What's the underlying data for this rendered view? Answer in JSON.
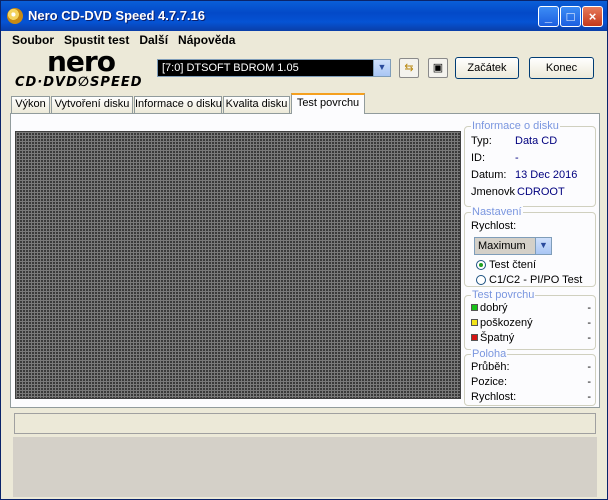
{
  "window": {
    "title": "Nero CD-DVD Speed 4.7.7.16"
  },
  "menu": [
    "Soubor",
    "Spustit test",
    "Další",
    "Nápověda"
  ],
  "logo": {
    "top": "nero",
    "bottom": "CD·DVD∅SPEED"
  },
  "toolbar": {
    "drive": "[7:0]  DTSOFT BDROM 1.05",
    "start_label": "Začátek",
    "end_label": "Konec"
  },
  "tabs": [
    "Výkon",
    "Vytvoření disku",
    "Informace o disku",
    "Kvalita disku",
    "Test povrchu"
  ],
  "active_tab": "Test povrchu",
  "disc_info": {
    "title": "Informace o disku",
    "rows": [
      {
        "label": "Typ:",
        "value": "Data CD"
      },
      {
        "label": "ID:",
        "value": "-"
      },
      {
        "label": "Datum:",
        "value": "13 Dec 2016"
      },
      {
        "label": "Jmenovk",
        "value": "CDROOT"
      }
    ]
  },
  "settings": {
    "title": "Nastavení",
    "speed_label": "Rychlost:",
    "speed_value": "Maximum",
    "options": [
      "Test čtení",
      "C1/C2 - PI/PO Test"
    ],
    "selected": "Test čtení"
  },
  "surface": {
    "title": "Test povrchu",
    "legend": [
      {
        "label": "dobrý",
        "value": "-",
        "color": "#19c119"
      },
      {
        "label": "poškozený",
        "value": "-",
        "color": "#f2e31a"
      },
      {
        "label": "Špatný",
        "value": "-",
        "color": "#d41414"
      }
    ]
  },
  "position": {
    "title": "Poloha",
    "rows": [
      {
        "label": "Průběh:",
        "value": "-"
      },
      {
        "label": "Pozice:",
        "value": "-"
      },
      {
        "label": "Rychlost:",
        "value": "-"
      }
    ]
  },
  "colors": {
    "titlebar": "#0349c8",
    "group_title": "#7a96df",
    "value_text": "#00007f"
  }
}
